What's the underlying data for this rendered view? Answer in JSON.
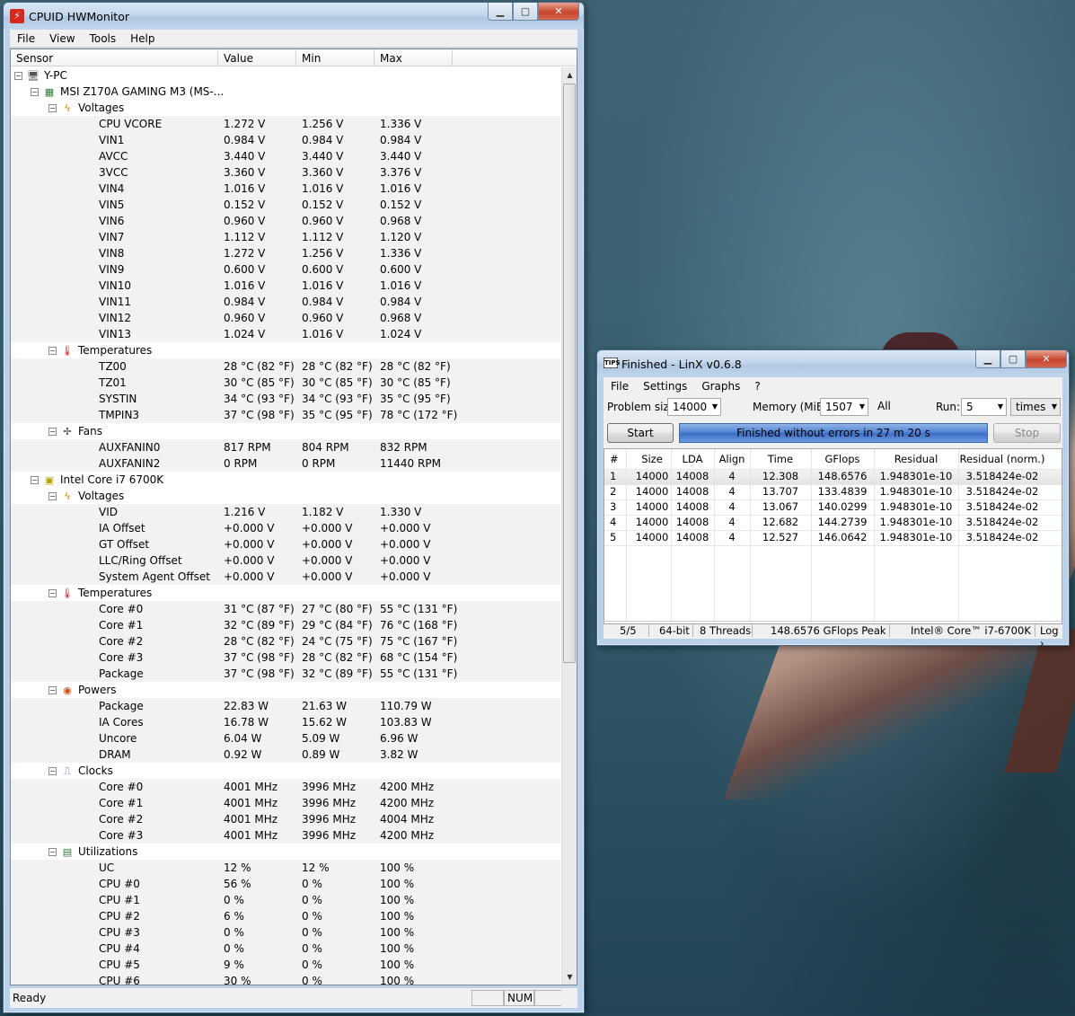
{
  "hwm": {
    "title": "CPUID HWMonitor",
    "menu": [
      "File",
      "View",
      "Tools",
      "Help"
    ],
    "columns": {
      "sensor": "Sensor",
      "value": "Value",
      "min": "Min",
      "max": "Max"
    },
    "status": {
      "left": "Ready",
      "num": "NUM"
    },
    "rows": [
      {
        "lvl": 0,
        "type": "node",
        "icon": "computer-icon",
        "label": "Y-PC"
      },
      {
        "lvl": 1,
        "type": "node",
        "icon": "motherboard-icon",
        "label": "MSI Z170A GAMING M3 (MS-..."
      },
      {
        "lvl": 2,
        "type": "node",
        "icon": "voltage-icon",
        "label": "Voltages"
      },
      {
        "lvl": 3,
        "type": "leaf",
        "label": "CPU VCORE",
        "v": "1.272 V",
        "min": "1.256 V",
        "max": "1.336 V"
      },
      {
        "lvl": 3,
        "type": "leaf",
        "label": "VIN1",
        "v": "0.984 V",
        "min": "0.984 V",
        "max": "0.984 V"
      },
      {
        "lvl": 3,
        "type": "leaf",
        "label": "AVCC",
        "v": "3.440 V",
        "min": "3.440 V",
        "max": "3.440 V"
      },
      {
        "lvl": 3,
        "type": "leaf",
        "label": "3VCC",
        "v": "3.360 V",
        "min": "3.360 V",
        "max": "3.376 V"
      },
      {
        "lvl": 3,
        "type": "leaf",
        "label": "VIN4",
        "v": "1.016 V",
        "min": "1.016 V",
        "max": "1.016 V"
      },
      {
        "lvl": 3,
        "type": "leaf",
        "label": "VIN5",
        "v": "0.152 V",
        "min": "0.152 V",
        "max": "0.152 V"
      },
      {
        "lvl": 3,
        "type": "leaf",
        "label": "VIN6",
        "v": "0.960 V",
        "min": "0.960 V",
        "max": "0.968 V"
      },
      {
        "lvl": 3,
        "type": "leaf",
        "label": "VIN7",
        "v": "1.112 V",
        "min": "1.112 V",
        "max": "1.120 V"
      },
      {
        "lvl": 3,
        "type": "leaf",
        "label": "VIN8",
        "v": "1.272 V",
        "min": "1.256 V",
        "max": "1.336 V"
      },
      {
        "lvl": 3,
        "type": "leaf",
        "label": "VIN9",
        "v": "0.600 V",
        "min": "0.600 V",
        "max": "0.600 V"
      },
      {
        "lvl": 3,
        "type": "leaf",
        "label": "VIN10",
        "v": "1.016 V",
        "min": "1.016 V",
        "max": "1.016 V"
      },
      {
        "lvl": 3,
        "type": "leaf",
        "label": "VIN11",
        "v": "0.984 V",
        "min": "0.984 V",
        "max": "0.984 V"
      },
      {
        "lvl": 3,
        "type": "leaf",
        "label": "VIN12",
        "v": "0.960 V",
        "min": "0.960 V",
        "max": "0.968 V"
      },
      {
        "lvl": 3,
        "type": "leaf",
        "label": "VIN13",
        "v": "1.024 V",
        "min": "1.016 V",
        "max": "1.024 V"
      },
      {
        "lvl": 2,
        "type": "node",
        "icon": "thermometer-icon",
        "label": "Temperatures"
      },
      {
        "lvl": 3,
        "type": "leaf",
        "label": "TZ00",
        "v": "28 °C  (82 °F)",
        "min": "28 °C  (82 °F)",
        "max": "28 °C  (82 °F)"
      },
      {
        "lvl": 3,
        "type": "leaf",
        "label": "TZ01",
        "v": "30 °C  (85 °F)",
        "min": "30 °C  (85 °F)",
        "max": "30 °C  (85 °F)"
      },
      {
        "lvl": 3,
        "type": "leaf",
        "label": "SYSTIN",
        "v": "34 °C  (93 °F)",
        "min": "34 °C  (93 °F)",
        "max": "35 °C  (95 °F)"
      },
      {
        "lvl": 3,
        "type": "leaf",
        "label": "TMPIN3",
        "v": "37 °C  (98 °F)",
        "min": "35 °C  (95 °F)",
        "max": "78 °C  (172 °F)"
      },
      {
        "lvl": 2,
        "type": "node",
        "icon": "fan-icon",
        "label": "Fans"
      },
      {
        "lvl": 3,
        "type": "leaf",
        "label": "AUXFANIN0",
        "v": "817 RPM",
        "min": "804 RPM",
        "max": "832 RPM"
      },
      {
        "lvl": 3,
        "type": "leaf",
        "label": "AUXFANIN2",
        "v": "0 RPM",
        "min": "0 RPM",
        "max": "11440 RPM"
      },
      {
        "lvl": 1,
        "type": "node",
        "icon": "cpu-chip-icon",
        "label": "Intel Core i7 6700K"
      },
      {
        "lvl": 2,
        "type": "node",
        "icon": "voltage-icon",
        "label": "Voltages"
      },
      {
        "lvl": 3,
        "type": "leaf",
        "label": "VID",
        "v": "1.216 V",
        "min": "1.182 V",
        "max": "1.330 V"
      },
      {
        "lvl": 3,
        "type": "leaf",
        "label": "IA Offset",
        "v": "+0.000 V",
        "min": "+0.000 V",
        "max": "+0.000 V"
      },
      {
        "lvl": 3,
        "type": "leaf",
        "label": "GT Offset",
        "v": "+0.000 V",
        "min": "+0.000 V",
        "max": "+0.000 V"
      },
      {
        "lvl": 3,
        "type": "leaf",
        "label": "LLC/Ring Offset",
        "v": "+0.000 V",
        "min": "+0.000 V",
        "max": "+0.000 V"
      },
      {
        "lvl": 3,
        "type": "leaf",
        "label": "System Agent Offset",
        "v": "+0.000 V",
        "min": "+0.000 V",
        "max": "+0.000 V"
      },
      {
        "lvl": 2,
        "type": "node",
        "icon": "thermometer-icon",
        "label": "Temperatures"
      },
      {
        "lvl": 3,
        "type": "leaf",
        "label": "Core #0",
        "v": "31 °C  (87 °F)",
        "min": "27 °C  (80 °F)",
        "max": "55 °C  (131 °F)"
      },
      {
        "lvl": 3,
        "type": "leaf",
        "label": "Core #1",
        "v": "32 °C  (89 °F)",
        "min": "29 °C  (84 °F)",
        "max": "76 °C  (168 °F)"
      },
      {
        "lvl": 3,
        "type": "leaf",
        "label": "Core #2",
        "v": "28 °C  (82 °F)",
        "min": "24 °C  (75 °F)",
        "max": "75 °C  (167 °F)"
      },
      {
        "lvl": 3,
        "type": "leaf",
        "label": "Core #3",
        "v": "37 °C  (98 °F)",
        "min": "28 °C  (82 °F)",
        "max": "68 °C  (154 °F)"
      },
      {
        "lvl": 3,
        "type": "leaf",
        "label": "Package",
        "v": "37 °C  (98 °F)",
        "min": "32 °C  (89 °F)",
        "max": "55 °C  (131 °F)"
      },
      {
        "lvl": 2,
        "type": "node",
        "icon": "power-icon",
        "label": "Powers"
      },
      {
        "lvl": 3,
        "type": "leaf",
        "label": "Package",
        "v": "22.83 W",
        "min": "21.63 W",
        "max": "110.79 W"
      },
      {
        "lvl": 3,
        "type": "leaf",
        "label": "IA Cores",
        "v": "16.78 W",
        "min": "15.62 W",
        "max": "103.83 W"
      },
      {
        "lvl": 3,
        "type": "leaf",
        "label": "Uncore",
        "v": "6.04 W",
        "min": "5.09 W",
        "max": "6.96 W"
      },
      {
        "lvl": 3,
        "type": "leaf",
        "label": "DRAM",
        "v": "0.92 W",
        "min": "0.89 W",
        "max": "3.82 W"
      },
      {
        "lvl": 2,
        "type": "node",
        "icon": "clock-icon",
        "label": "Clocks"
      },
      {
        "lvl": 3,
        "type": "leaf",
        "label": "Core #0",
        "v": "4001 MHz",
        "min": "3996 MHz",
        "max": "4200 MHz"
      },
      {
        "lvl": 3,
        "type": "leaf",
        "label": "Core #1",
        "v": "4001 MHz",
        "min": "3996 MHz",
        "max": "4200 MHz"
      },
      {
        "lvl": 3,
        "type": "leaf",
        "label": "Core #2",
        "v": "4001 MHz",
        "min": "3996 MHz",
        "max": "4004 MHz"
      },
      {
        "lvl": 3,
        "type": "leaf",
        "label": "Core #3",
        "v": "4001 MHz",
        "min": "3996 MHz",
        "max": "4200 MHz"
      },
      {
        "lvl": 2,
        "type": "node",
        "icon": "utilization-icon",
        "label": "Utilizations"
      },
      {
        "lvl": 3,
        "type": "leaf",
        "label": "UC",
        "v": "12 %",
        "min": "12 %",
        "max": "100 %"
      },
      {
        "lvl": 3,
        "type": "leaf",
        "label": "CPU #0",
        "v": "56 %",
        "min": "0 %",
        "max": "100 %"
      },
      {
        "lvl": 3,
        "type": "leaf",
        "label": "CPU #1",
        "v": "0 %",
        "min": "0 %",
        "max": "100 %"
      },
      {
        "lvl": 3,
        "type": "leaf",
        "label": "CPU #2",
        "v": "6 %",
        "min": "0 %",
        "max": "100 %"
      },
      {
        "lvl": 3,
        "type": "leaf",
        "label": "CPU #3",
        "v": "0 %",
        "min": "0 %",
        "max": "100 %"
      },
      {
        "lvl": 3,
        "type": "leaf",
        "label": "CPU #4",
        "v": "0 %",
        "min": "0 %",
        "max": "100 %"
      },
      {
        "lvl": 3,
        "type": "leaf",
        "label": "CPU #5",
        "v": "9 %",
        "min": "0 %",
        "max": "100 %"
      },
      {
        "lvl": 3,
        "type": "leaf",
        "label": "CPU #6",
        "v": "30 %",
        "min": "0 %",
        "max": "100 %"
      }
    ]
  },
  "linx": {
    "title": "Finished - LinX v0.6.8",
    "icon_text": "TIPS",
    "menu": [
      "File",
      "Settings",
      "Graphs",
      "?"
    ],
    "problem_size_label": "Problem size:",
    "problem_size": "14000",
    "memory_label": "Memory (MiB):",
    "memory": "1507",
    "all_label": "All",
    "run_label": "Run:",
    "run": "5",
    "run_unit": "times",
    "start_label": "Start",
    "stop_label": "Stop",
    "progress_text": "Finished without errors in 27 m 20 s",
    "progress_fraction": 1.0,
    "table": {
      "headers": [
        "#",
        "Size",
        "LDA",
        "Align",
        "Time",
        "GFlops",
        "Residual",
        "Residual (norm.)"
      ],
      "rows": [
        [
          "1",
          "14000",
          "14008",
          "4",
          "12.308",
          "148.6576",
          "1.948301e-10",
          "3.518424e-02"
        ],
        [
          "2",
          "14000",
          "14008",
          "4",
          "13.707",
          "133.4839",
          "1.948301e-10",
          "3.518424e-02"
        ],
        [
          "3",
          "14000",
          "14008",
          "4",
          "13.067",
          "140.0299",
          "1.948301e-10",
          "3.518424e-02"
        ],
        [
          "4",
          "14000",
          "14008",
          "4",
          "12.682",
          "144.2739",
          "1.948301e-10",
          "3.518424e-02"
        ],
        [
          "5",
          "14000",
          "14008",
          "4",
          "12.527",
          "146.0642",
          "1.948301e-10",
          "3.518424e-02"
        ]
      ]
    },
    "status": {
      "runs": "5/5",
      "bits": "64-bit",
      "threads": "8 Threads",
      "peak": "148.6576 GFlops Peak",
      "cpu": "Intel® Core™ i7-6700K",
      "log": "Log ›"
    }
  }
}
